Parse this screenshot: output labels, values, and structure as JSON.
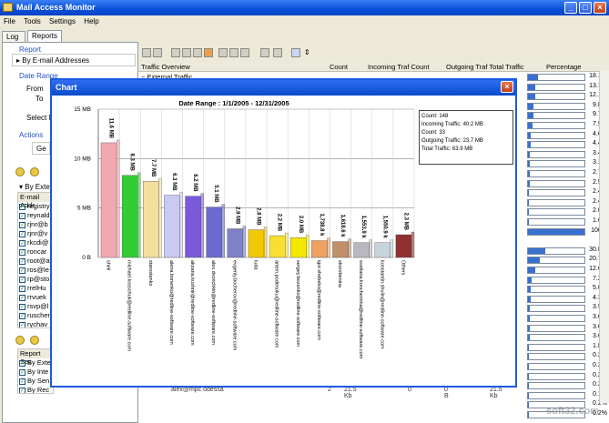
{
  "window": {
    "title": "Mail Access Monitor"
  },
  "menu": [
    "File",
    "Tools",
    "Settings",
    "Help"
  ],
  "tabs": [
    {
      "label": "Log"
    },
    {
      "label": "Reports"
    }
  ],
  "left": {
    "report_label": "Report",
    "report_value": "By E-mail Addresses",
    "daterange_label": "Date Range",
    "from_label": "From",
    "to_label": "To",
    "select_label": "Select M",
    "actions_label": "Actions",
    "go_label": "Ge",
    "by_ext_label": "By Exter",
    "email_header": "E-mail Addr",
    "emails": [
      "registry",
      "reynald",
      "rjnr@b",
      "rjnr@v",
      "rkcdi@",
      "roncar",
      "root@a",
      "ros@le",
      "rp@sto",
      "rrelHu",
      "rrvuek",
      "rsvp@l",
      "ruschen",
      "rychav"
    ],
    "report_sec_label": "Report Sec",
    "sections": [
      "By Exte",
      "By Inte",
      "By Sen",
      "By Rec"
    ]
  },
  "grid": {
    "columns": [
      "Traffic Overview",
      "Count",
      "Incoming Traf Count",
      "Outgoing Traf Total Traffic",
      "Percentage"
    ],
    "first_row": "External Traffic",
    "percentages": [
      {
        "text": "18.1%",
        "value": 18.1
      },
      {
        "text": "13.1%",
        "value": 13.1
      },
      {
        "text": "12.1%",
        "value": 12.1
      },
      {
        "text": "9.8%",
        "value": 9.8
      },
      {
        "text": "9.7%",
        "value": 9.7
      },
      {
        "text": "7.9%",
        "value": 7.9
      },
      {
        "text": "4.6%",
        "value": 4.6
      },
      {
        "text": "4.4%",
        "value": 4.4
      },
      {
        "text": "3.4%",
        "value": 3.4
      },
      {
        "text": "3.1%",
        "value": 3.1
      },
      {
        "text": "2.7%",
        "value": 2.7
      },
      {
        "text": "2.5%",
        "value": 2.5
      },
      {
        "text": "2.4%",
        "value": 2.4
      },
      {
        "text": "2.4%",
        "value": 2.4
      },
      {
        "text": "2.0%",
        "value": 2.0
      },
      {
        "text": "1.6%",
        "value": 1.6
      },
      {
        "text": "100%",
        "value": 100
      },
      {
        "text": "",
        "value": 0
      },
      {
        "text": "30.8%",
        "value": 30.8
      },
      {
        "text": "20.7%",
        "value": 20.7
      },
      {
        "text": "12.6%",
        "value": 12.6
      },
      {
        "text": "7.2%",
        "value": 7.2
      },
      {
        "text": "5.0%",
        "value": 5.0
      },
      {
        "text": "4.3%",
        "value": 4.3
      },
      {
        "text": "3.9%",
        "value": 3.9
      },
      {
        "text": "3.6%",
        "value": 3.6
      },
      {
        "text": "3.6%",
        "value": 3.6
      },
      {
        "text": "3.6%",
        "value": 3.6
      },
      {
        "text": "1.8%",
        "value": 1.8
      },
      {
        "text": "0.2%",
        "value": 0.2
      },
      {
        "text": "0.2%",
        "value": 0.2
      },
      {
        "text": "0.2%",
        "value": 0.2
      },
      {
        "text": "0.2%",
        "value": 0.2
      },
      {
        "text": "0.1%",
        "value": 0.1
      },
      {
        "text": "0.2%",
        "value": 0.2
      },
      {
        "text": "0.2%",
        "value": 0.2
      }
    ],
    "tail_row": [
      "alex@mpc.odessa",
      "2",
      "21.5 Kb",
      "0",
      "0 B",
      "21.5 Kb"
    ]
  },
  "chart_window": {
    "title": "Chart",
    "info": [
      "Count: 148",
      "Incoming Traffic: 40.2 MB",
      "Count: 33",
      "Outgoing Traffic: 23.7 MB",
      "Total Traffic: 63.9 MB"
    ]
  },
  "chart_data": {
    "type": "bar",
    "title": "Date Range :  1/1/2005  -  12/31/2005",
    "ylim": [
      0,
      15
    ],
    "yticks": [
      {
        "label": "15 MB",
        "value": 15
      },
      {
        "label": "10 MB",
        "value": 10
      },
      {
        "label": "5 MB",
        "value": 5
      },
      {
        "label": "0 B",
        "value": 0
      }
    ],
    "categories": [
      "sheil",
      "michael.kosschuk@redline-software.com",
      "starostenko",
      "alena.bonenko@redline-software.com",
      "aksana.kushnir@redline-software.com",
      "alex.dvorichkin@redline-software.com",
      "evgeniy.bocherov@redline-software.com",
      "luda",
      "artem.podenoku@redline-software.com",
      "sergey.bozenko@redline-software.com",
      "igor.shebeko@redline-software.com",
      "skorobenina",
      "svetlana.konchemina@redline-software.com",
      "konstantin.shulin@redline-software.com",
      "Others"
    ],
    "values": [
      11.6,
      8.3,
      7.7,
      6.3,
      6.2,
      5.1,
      2.9,
      2.8,
      2.2,
      2.0,
      1.7,
      1.6,
      1.5,
      1.5,
      2.3
    ],
    "value_labels": [
      "11.6 MB",
      "8.3 MB",
      "7.7 MB",
      "6.3 MB",
      "6.2 MB",
      "5.1 MB",
      "2.9 MB",
      "2.8 MB",
      "2.2 MB",
      "2.0 MB",
      "1,738.8 k",
      "1,618.6 k",
      "1,553.9 k",
      "1,550.9 k",
      "2.3 MB"
    ],
    "colors": [
      "#f2a8b0",
      "#33cc33",
      "#f2e09a",
      "#c9c9f2",
      "#7a5ad8",
      "#6a6ad0",
      "#8080c8",
      "#f2c800",
      "#f8e030",
      "#f5e800",
      "#f0a060",
      "#c0906a",
      "#b8b8c0",
      "#c8d4dc",
      "#903030"
    ]
  },
  "watermark": "soft32.com"
}
